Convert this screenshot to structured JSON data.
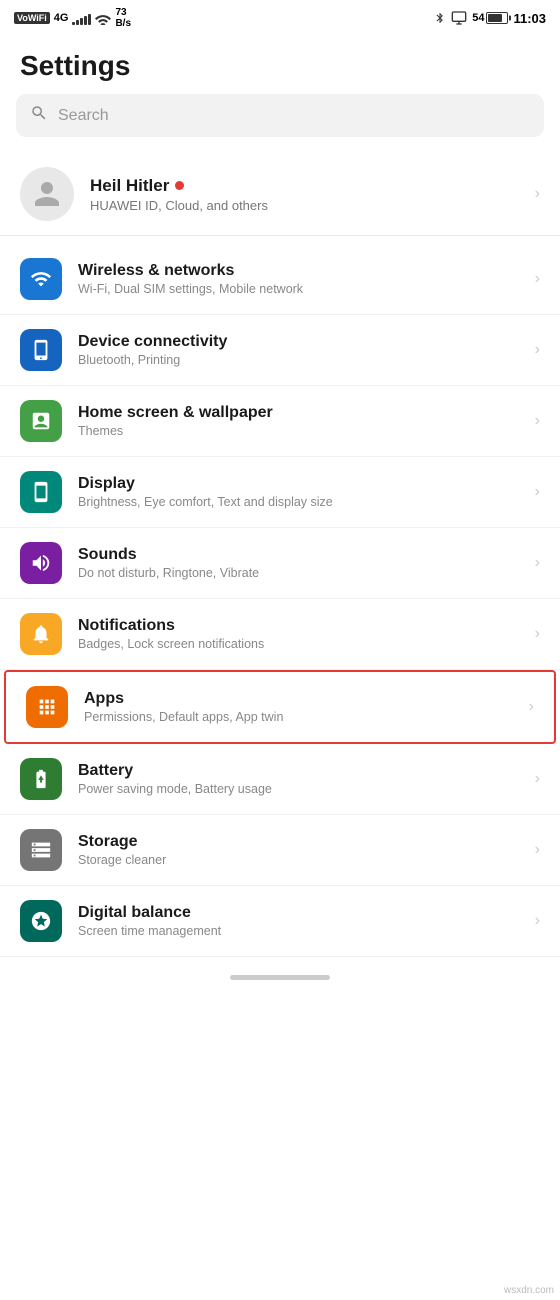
{
  "statusBar": {
    "carrier": "VoWiFi",
    "signal": "4G",
    "wifi": "WiFi",
    "speed": "73 B/s",
    "bluetooth": "BT",
    "battery": "54",
    "time": "11:03"
  },
  "page": {
    "title": "Settings"
  },
  "search": {
    "placeholder": "Search"
  },
  "profile": {
    "name": "Heil Hitler",
    "subtitle": "HUAWEI ID, Cloud, and others"
  },
  "settingsItems": [
    {
      "id": "wireless",
      "iconColor": "icon-blue",
      "iconSymbol": "wifi",
      "title": "Wireless & networks",
      "subtitle": "Wi-Fi, Dual SIM settings, Mobile network",
      "highlighted": false
    },
    {
      "id": "connectivity",
      "iconColor": "icon-blue2",
      "iconSymbol": "device",
      "title": "Device connectivity",
      "subtitle": "Bluetooth, Printing",
      "highlighted": false
    },
    {
      "id": "homescreen",
      "iconColor": "icon-green",
      "iconSymbol": "home",
      "title": "Home screen & wallpaper",
      "subtitle": "Themes",
      "highlighted": false
    },
    {
      "id": "display",
      "iconColor": "icon-teal",
      "iconSymbol": "display",
      "title": "Display",
      "subtitle": "Brightness, Eye comfort, Text and display size",
      "highlighted": false
    },
    {
      "id": "sounds",
      "iconColor": "icon-purple",
      "iconSymbol": "sound",
      "title": "Sounds",
      "subtitle": "Do not disturb, Ringtone, Vibrate",
      "highlighted": false
    },
    {
      "id": "notifications",
      "iconColor": "icon-yellow",
      "iconSymbol": "notification",
      "title": "Notifications",
      "subtitle": "Badges, Lock screen notifications",
      "highlighted": false
    },
    {
      "id": "apps",
      "iconColor": "icon-orange",
      "iconSymbol": "apps",
      "title": "Apps",
      "subtitle": "Permissions, Default apps, App twin",
      "highlighted": true
    },
    {
      "id": "battery",
      "iconColor": "icon-green2",
      "iconSymbol": "battery",
      "title": "Battery",
      "subtitle": "Power saving mode, Battery usage",
      "highlighted": false
    },
    {
      "id": "storage",
      "iconColor": "icon-gray",
      "iconSymbol": "storage",
      "title": "Storage",
      "subtitle": "Storage cleaner",
      "highlighted": false
    },
    {
      "id": "digitalbalance",
      "iconColor": "icon-teal2",
      "iconSymbol": "balance",
      "title": "Digital balance",
      "subtitle": "Screen time management",
      "highlighted": false
    }
  ],
  "watermark": "wsxdn.com"
}
